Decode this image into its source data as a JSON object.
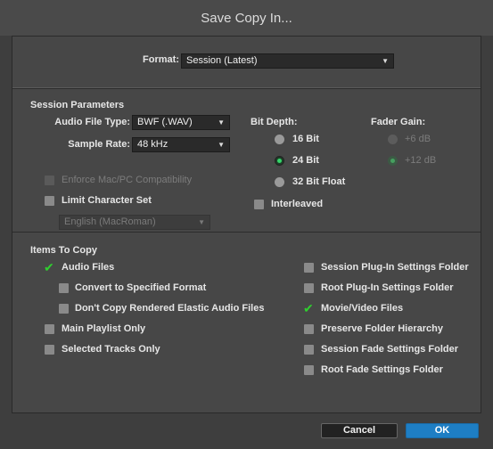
{
  "window": {
    "title": "Save Copy In..."
  },
  "format": {
    "label": "Format:",
    "value": "Session (Latest)"
  },
  "session_parameters": {
    "heading": "Session Parameters",
    "audio_file_type": {
      "label": "Audio File Type:",
      "value": "BWF (.WAV)"
    },
    "sample_rate": {
      "label": "Sample Rate:",
      "value": "48 kHz"
    },
    "enforce_compat": {
      "label": "Enforce Mac/PC Compatibility",
      "checked": false,
      "enabled": false
    },
    "limit_charset": {
      "label": "Limit Character Set",
      "checked": false,
      "enabled": true
    },
    "charset": {
      "value": "English (MacRoman)",
      "enabled": false
    },
    "bit_depth": {
      "heading": "Bit Depth:",
      "options": [
        "16 Bit",
        "24 Bit",
        "32 Bit Float"
      ],
      "selected": "24 Bit"
    },
    "interleaved": {
      "label": "Interleaved",
      "checked": false
    },
    "fader_gain": {
      "heading": "Fader Gain:",
      "options": [
        "+6 dB",
        "+12 dB"
      ],
      "selected": "+12 dB",
      "enabled": false
    }
  },
  "items_to_copy": {
    "heading": "Items To Copy",
    "left": [
      {
        "label": "Audio Files",
        "checked": true
      },
      {
        "label": "Convert to Specified Format",
        "checked": false
      },
      {
        "label": "Don't Copy Rendered Elastic Audio Files",
        "checked": false
      },
      {
        "label": "Main Playlist Only",
        "checked": false
      },
      {
        "label": "Selected Tracks Only",
        "checked": false
      }
    ],
    "right": [
      {
        "label": "Session Plug-In Settings Folder",
        "checked": false
      },
      {
        "label": "Root Plug-In Settings Folder",
        "checked": false
      },
      {
        "label": "Movie/Video Files",
        "checked": true
      },
      {
        "label": "Preserve Folder Hierarchy",
        "checked": false
      },
      {
        "label": "Session Fade Settings Folder",
        "checked": false
      },
      {
        "label": "Root Fade Settings Folder",
        "checked": false
      }
    ]
  },
  "buttons": {
    "cancel": "Cancel",
    "ok": "OK"
  },
  "colors": {
    "ok_button": "#1e7ec4",
    "check_green": "#2fcf2f",
    "radio_green": "#35d56a",
    "background": "#3e3e3e"
  }
}
